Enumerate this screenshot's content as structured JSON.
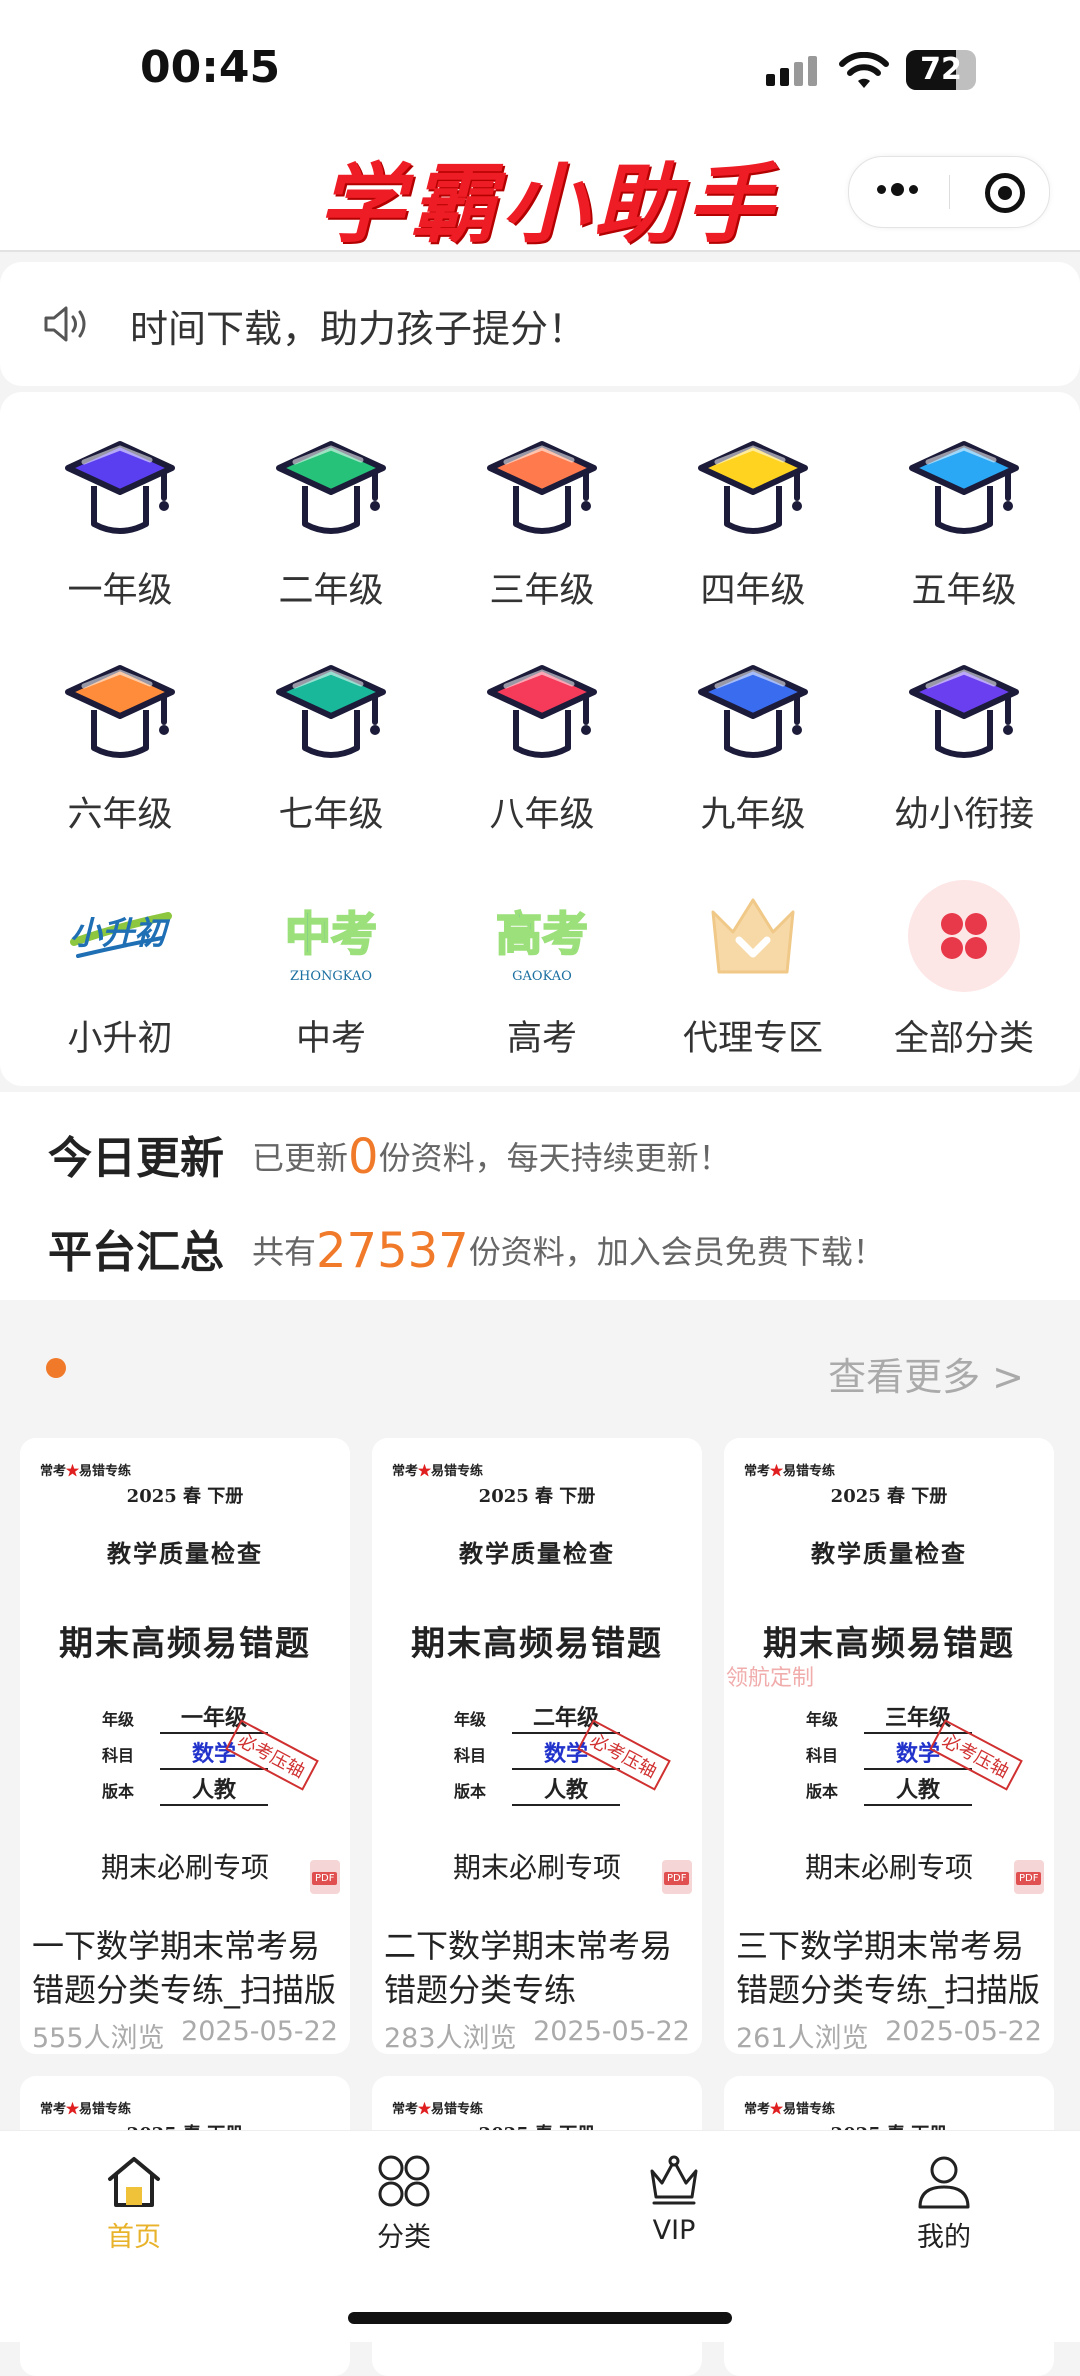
{
  "status": {
    "time": "00:45",
    "battery": "72",
    "battery_level": 0.72
  },
  "app": {
    "title": "学霸小助手"
  },
  "notice": {
    "text": "时间下载，助力孩子提分！"
  },
  "categories": [
    {
      "label": "一年级",
      "icon": "graduation-cap-icon",
      "color": "#5a3ff0"
    },
    {
      "label": "二年级",
      "icon": "graduation-cap-icon",
      "color": "#27c27a"
    },
    {
      "label": "三年级",
      "icon": "graduation-cap-icon",
      "color": "#ff7a4d"
    },
    {
      "label": "四年级",
      "icon": "graduation-cap-icon",
      "color": "#ffd320"
    },
    {
      "label": "五年级",
      "icon": "graduation-cap-icon",
      "color": "#2aa8f5"
    },
    {
      "label": "六年级",
      "icon": "graduation-cap-icon",
      "color": "#ff8c3a"
    },
    {
      "label": "七年级",
      "icon": "graduation-cap-icon",
      "color": "#19b89a"
    },
    {
      "label": "八年级",
      "icon": "graduation-cap-icon",
      "color": "#f53a5a"
    },
    {
      "label": "九年级",
      "icon": "graduation-cap-icon",
      "color": "#3a6cf0"
    },
    {
      "label": "幼小衔接",
      "icon": "graduation-cap-icon",
      "color": "#6a3ff0"
    },
    {
      "label": "小升初",
      "icon": "xiaoshengchu-logo",
      "logo_text": "小升初"
    },
    {
      "label": "中考",
      "icon": "zhongkao-logo",
      "logo_text": "中考",
      "logo_sub": "ZHONGKAO"
    },
    {
      "label": "高考",
      "icon": "gaokao-logo",
      "logo_text": "高考",
      "logo_sub": "GAOKAO"
    },
    {
      "label": "代理专区",
      "icon": "crown-icon"
    },
    {
      "label": "全部分类",
      "icon": "all-categories-icon"
    }
  ],
  "stats": {
    "today_label": "今日更新",
    "today_prefix": "已更新",
    "today_count": "0",
    "today_suffix": "份资料，每天持续更新！",
    "total_label": "平台汇总",
    "total_prefix": "共有",
    "total_count": "27537",
    "total_suffix": "份资料，加入会员免费下载！"
  },
  "section": {
    "more_label": "查看更多 >"
  },
  "cover_common": {
    "tag_a": "常考",
    "tag_star": "★",
    "tag_b": "易错专练",
    "term": "2025 春  下册",
    "title1": "教学质量检查",
    "title2": "期末高频易错题",
    "grade_field": "年级",
    "subject_field": "科目",
    "edition_field": "版本",
    "subject_value": "数学",
    "edition_value": "人教",
    "stamp": "必考压轴",
    "brush": "期末必刷专项",
    "pdf": "PDF",
    "watermark": "领航定制"
  },
  "cards": [
    {
      "grade": "一年级",
      "title": "一下数学期末常考易错题分类专练_扫描版",
      "views": "555人浏览",
      "date": "2025-05-22"
    },
    {
      "grade": "二年级",
      "title": "二下数学期末常考易错题分类专练",
      "views": "283人浏览",
      "date": "2025-05-22"
    },
    {
      "grade": "三年级",
      "title": "三下数学期末常考易错题分类专练_扫描版",
      "views": "261人浏览",
      "date": "2025-05-22"
    }
  ],
  "tabs": [
    {
      "label": "首页",
      "icon": "home-icon",
      "active": true
    },
    {
      "label": "分类",
      "icon": "category-icon",
      "active": false
    },
    {
      "label": "VIP",
      "icon": "vip-crown-icon",
      "active": false
    },
    {
      "label": "我的",
      "icon": "profile-icon",
      "active": false
    }
  ],
  "colors": {
    "accent": "#f07a2a",
    "title_red": "#ee1c25",
    "tab_active": "#e8b22a"
  }
}
